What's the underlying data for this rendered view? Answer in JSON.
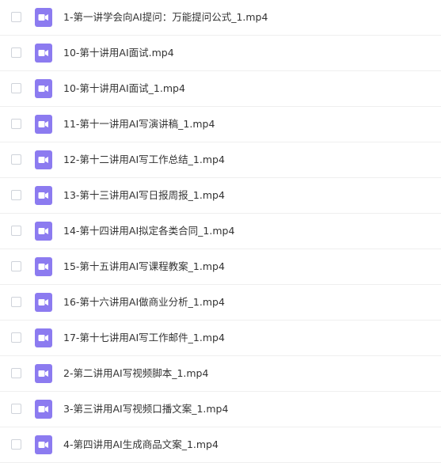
{
  "files": [
    {
      "name": "1-第一讲学会向AI提问：万能提问公式_1.mp4",
      "icon": "video-file-icon",
      "checked": false
    },
    {
      "name": "10-第十讲用AI面试.mp4",
      "icon": "video-file-icon",
      "checked": false
    },
    {
      "name": "10-第十讲用AI面试_1.mp4",
      "icon": "video-file-icon",
      "checked": false
    },
    {
      "name": "11-第十一讲用AI写演讲稿_1.mp4",
      "icon": "video-file-icon",
      "checked": false
    },
    {
      "name": "12-第十二讲用AI写工作总结_1.mp4",
      "icon": "video-file-icon",
      "checked": false
    },
    {
      "name": "13-第十三讲用AI写日报周报_1.mp4",
      "icon": "video-file-icon",
      "checked": false
    },
    {
      "name": "14-第十四讲用AI拟定各类合同_1.mp4",
      "icon": "video-file-icon",
      "checked": false
    },
    {
      "name": "15-第十五讲用AI写课程教案_1.mp4",
      "icon": "video-file-icon",
      "checked": false
    },
    {
      "name": "16-第十六讲用AI做商业分析_1.mp4",
      "icon": "video-file-icon",
      "checked": false
    },
    {
      "name": "17-第十七讲用AI写工作邮件_1.mp4",
      "icon": "video-file-icon",
      "checked": false
    },
    {
      "name": "2-第二讲用AI写视频脚本_1.mp4",
      "icon": "video-file-icon",
      "checked": false
    },
    {
      "name": "3-第三讲用AI写视频口播文案_1.mp4",
      "icon": "video-file-icon",
      "checked": false
    },
    {
      "name": "4-第四讲用AI生成商品文案_1.mp4",
      "icon": "video-file-icon",
      "checked": false
    }
  ],
  "colors": {
    "icon_bg": "#8c7bf0",
    "icon_glyph": "#ffffff",
    "text": "#333333",
    "checkbox_border": "#cfd3da",
    "divider": "#efefef"
  }
}
